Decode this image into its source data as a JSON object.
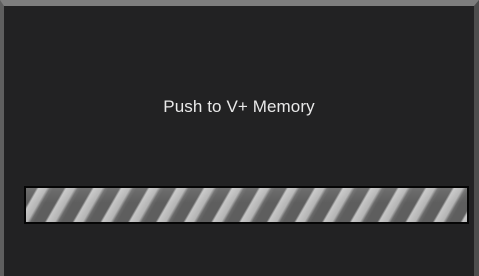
{
  "dialog": {
    "message": "Push to V+ Memory"
  },
  "progress": {
    "state": "indeterminate",
    "value": 1.0
  },
  "colors": {
    "background": "#222223",
    "text": "#e9e9e9",
    "stripe_dark": "#5e5e5e",
    "stripe_light": "#c6c6c6"
  }
}
